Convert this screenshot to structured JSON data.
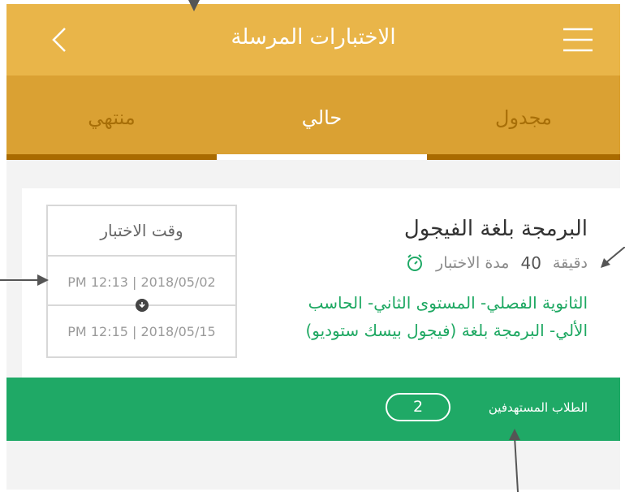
{
  "header": {
    "title": "الاختبارات المرسلة",
    "back_icon": "chevron-left-icon",
    "menu_icon": "hamburger-menu-icon"
  },
  "tabs": [
    {
      "label": "مجدول",
      "active": false
    },
    {
      "label": "حالي",
      "active": true
    },
    {
      "label": "منتهي",
      "active": false
    }
  ],
  "exam": {
    "title": "البرمجة بلغة الفيجول",
    "duration_label": "مدة الاختبار",
    "duration_value": "40",
    "duration_unit": "دقيقة",
    "levels_line1": "الثانوية الفصلي- المستوى الثاني- الحاسب",
    "levels_line2": "الألي- البرمجة بلغة (فيجول بيسك ستوديو)",
    "time_header": "وقت الاختبار",
    "start_time": "PM 12:13 | 2018/05/02",
    "end_time": "PM 12:15 | 2018/05/15",
    "target_label": "الطلاب المستهدفين",
    "target_count": "2"
  },
  "colors": {
    "header": "#e9b549",
    "tabs": "#daa133",
    "tab_inactive_text": "#a86f08",
    "green": "#1fa966",
    "background": "#f3f3f3"
  }
}
